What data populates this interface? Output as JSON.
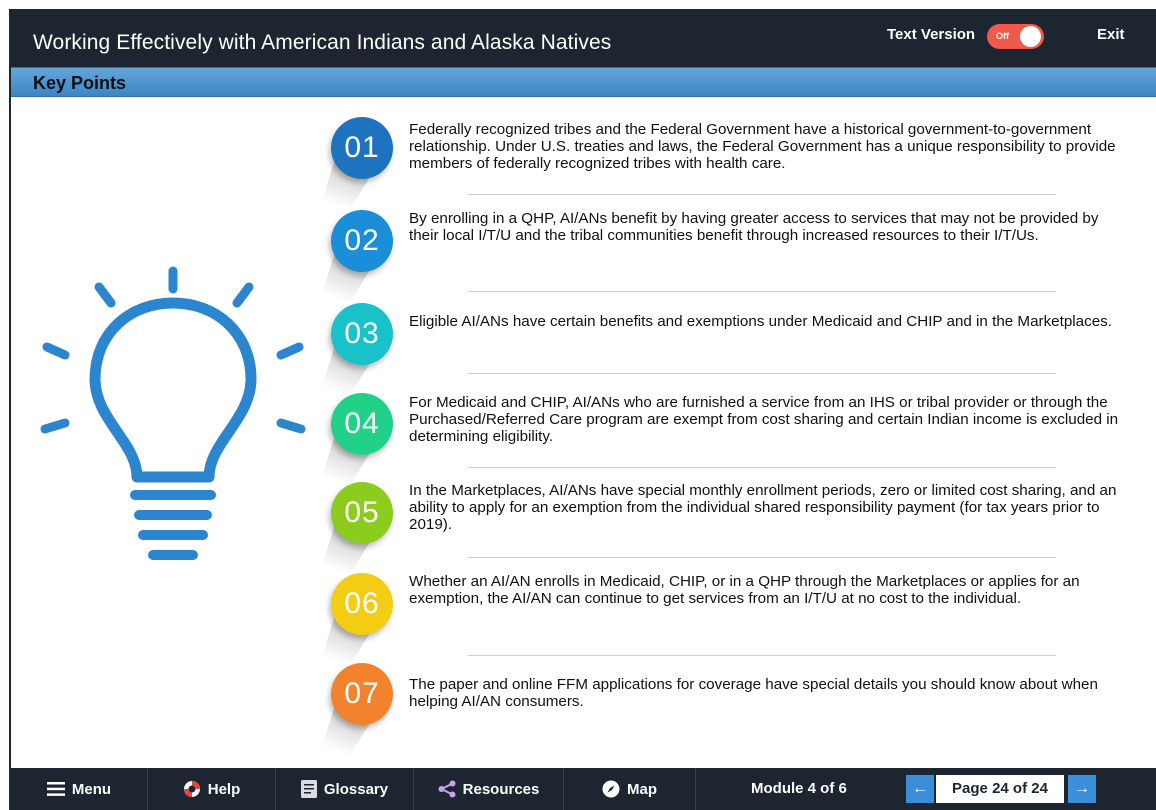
{
  "header": {
    "title": "Working Effectively with American Indians and Alaska Natives",
    "text_version_label": "Text Version",
    "toggle_label": "Off",
    "exit_label": "Exit"
  },
  "section": {
    "title": "Key Points"
  },
  "points": [
    {
      "number": "01",
      "color": "#1e73be",
      "text": "Federally recognized tribes and the Federal Government have a historical government-to-government relationship. Under U.S. treaties and laws, the Federal Government has a unique responsibility to provide members of federally recognized tribes with health care."
    },
    {
      "number": "02",
      "color": "#1a8ed6",
      "text": "By enrolling in a QHP, AI/ANs benefit by having greater access to services that may not be provided by their local I/T/U and the tribal communities benefit through increased resources to their I/T/Us."
    },
    {
      "number": "03",
      "color": "#19c1c9",
      "text": "Eligible AI/ANs have certain benefits and exemptions under Medicaid and CHIP and in the Marketplaces."
    },
    {
      "number": "04",
      "color": "#21d18a",
      "text": "For Medicaid and CHIP, AI/ANs who are furnished a service from an IHS or tribal provider or through the Purchased/Referred Care program are exempt from cost sharing and certain Indian income is excluded in determining eligibility."
    },
    {
      "number": "05",
      "color": "#8ccc1e",
      "text": "In the Marketplaces, AI/ANs have special monthly enrollment periods, zero or limited cost sharing, and an ability to apply for an exemption from the individual shared responsibility payment (for tax years prior to 2019)."
    },
    {
      "number": "06",
      "color": "#f3cc14",
      "text": "Whether an AI/AN enrolls in Medicaid, CHIP, or in a QHP through the Marketplaces or applies for an exemption, the AI/AN can continue to get services from an I/T/U at no cost to the individual."
    },
    {
      "number": "07",
      "color": "#f2832c",
      "text": "The paper and online FFM applications for coverage have special details you should know about when helping AI/AN consumers."
    }
  ],
  "footer": {
    "menu_label": "Menu",
    "help_label": "Help",
    "glossary_label": "Glossary",
    "resources_label": "Resources",
    "map_label": "Map",
    "module_label": "Module 4 of 6",
    "page_label": "Page 24 of 24",
    "prev_arrow": "←",
    "next_arrow": "→"
  },
  "colors": {
    "header_bg": "#1c2530",
    "section_bar": "#4a93cf",
    "bulb": "#2b86cf",
    "toggle": "#ef5a4b",
    "nav_arrow": "#3a8fd8"
  },
  "icons": {
    "bulb": "lightbulb-icon",
    "menu": "hamburger-icon",
    "help": "lifebuoy-icon",
    "glossary": "book-icon",
    "resources": "share-icon",
    "map": "compass-icon"
  }
}
